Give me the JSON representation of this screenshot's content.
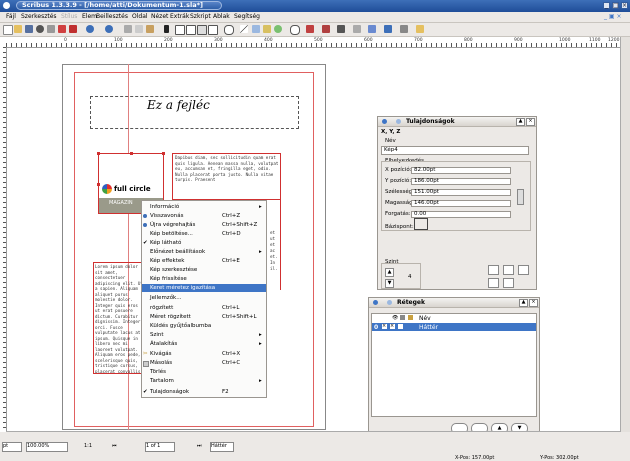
{
  "window": {
    "title": "Scribus 1.3.3.9 - [/home/atti/Dokumentum-1.sla*]"
  },
  "menubar": [
    "Fájl",
    "Szerkesztés",
    "Stílus",
    "Elem",
    "Beillesztés",
    "Oldal",
    "Nézet",
    "Extrák",
    "Szkript",
    "Ablak",
    "Segítség"
  ],
  "ruler": {
    "h_ticks": [
      "0",
      "100",
      "200",
      "300",
      "400",
      "500",
      "600",
      "700",
      "800",
      "900",
      "1000",
      "1100",
      "1200"
    ],
    "v_ticks": [
      "0",
      "100",
      "200",
      "300",
      "400",
      "500",
      "600",
      "700",
      "800"
    ]
  },
  "page": {
    "header_text": "Ez a fejléc",
    "logo_text": "full circle",
    "logo_sub": "MAGAZIN",
    "para_right": "Dapibus diam, sec sollicitudin quam erat quis ligula. Aenean massa nulla, volutpat eu, accumsan et, fringilla eget, odio. Nulla placerat porta justo. Nulla vitae turpis. Praesent",
    "para_left": "Lorem ipsum dolor sit amet, consectetuer adipiscing elit. Ut a sapien. Aliquam aliquet purus molestie dolor. Integer quis eros ut erat posuere dictum. Curabitur dignissim. Integer orci. Fusce vulputate lacus at ipsum. Quisque in libero nec mi laoreet volutpat. Aliquam eros pede, scelerisque quis, tristique cursus, placerat convallis, velit. Nam condimentum. Nulla ut mauris. Curabitur adipiscing, mauris non dictum aliquam, arcu risus",
    "para_right_bottom": "et ut et ac et. In il."
  },
  "context_menu": [
    {
      "label": "Információ",
      "shortcut": "",
      "arrow": true
    },
    {
      "label": "Visszavonás",
      "shortcut": "Ctrl+Z",
      "arrow": false
    },
    {
      "label": "Újra végrehajtás",
      "shortcut": "Ctrl+Shift+Z",
      "arrow": false
    },
    {
      "label": "Kép betöltése...",
      "shortcut": "Ctrl+D",
      "arrow": false
    },
    {
      "label": "Kép látható",
      "shortcut": "",
      "arrow": false,
      "check": true
    },
    {
      "label": "Előnézet beállítások",
      "shortcut": "",
      "arrow": true
    },
    {
      "label": "Kép effektek",
      "shortcut": "Ctrl+E",
      "arrow": false
    },
    {
      "label": "Kép szerkesztése",
      "shortcut": "",
      "arrow": false
    },
    {
      "label": "Kép frissítése",
      "shortcut": "",
      "arrow": false
    },
    {
      "label": "Keret méretez igazítása",
      "shortcut": "",
      "arrow": false,
      "selected": true
    },
    {
      "label": "Jellemzők...",
      "shortcut": "",
      "arrow": false
    },
    {
      "label": "rögzített",
      "shortcut": "Ctrl+L",
      "arrow": false
    },
    {
      "label": "Méret rögzített",
      "shortcut": "Ctrl+Shift+L",
      "arrow": false
    },
    {
      "label": "Küldés gyűjtőalbumba",
      "shortcut": "",
      "arrow": false
    },
    {
      "label": "Szint",
      "shortcut": "",
      "arrow": true
    },
    {
      "label": "Átalakítás",
      "shortcut": "",
      "arrow": true
    },
    {
      "label": "Kivágás",
      "shortcut": "Ctrl+X",
      "arrow": false
    },
    {
      "label": "Másolás",
      "shortcut": "Ctrl+C",
      "arrow": false
    },
    {
      "label": "Törlés",
      "shortcut": "",
      "arrow": false
    },
    {
      "label": "Tartalom",
      "shortcut": "",
      "arrow": true
    },
    {
      "label": "Tulajdonságok",
      "shortcut": "F2",
      "arrow": false,
      "check": true
    }
  ],
  "properties": {
    "title": "Tulajdonságok",
    "tab": "X, Y, Z",
    "name_label": "Név",
    "name_value": "Kép4",
    "geom_label": "Elhelyezkedés",
    "x_label": "X pozíció:",
    "x_value": "82.00pt",
    "y_label": "Y pozíció:",
    "y_value": "186.00pt",
    "w_label": "Szélesség:",
    "w_value": "151.00pt",
    "h_label": "Magasság:",
    "h_value": "146.00pt",
    "rot_label": "Forgatás:",
    "rot_value": "0.00",
    "base_label": "Bázispont:",
    "level_label": "Szint",
    "level_value": "4"
  },
  "layers": {
    "title": "Rétegek",
    "col_name": "Név",
    "row_index": "0",
    "row_name": "Háttér"
  },
  "status": {
    "zoom": "100.00%",
    "ratio": "1:1",
    "page": "1 of 1",
    "layer": "Háttér",
    "xpos": "X-Pos: 157.00pt",
    "ypos": "Y-Pos: 302.00pt"
  },
  "colors": {
    "accent": "#3e75c6",
    "titlebar": "#1f4d98",
    "frame_red": "#d03030"
  }
}
